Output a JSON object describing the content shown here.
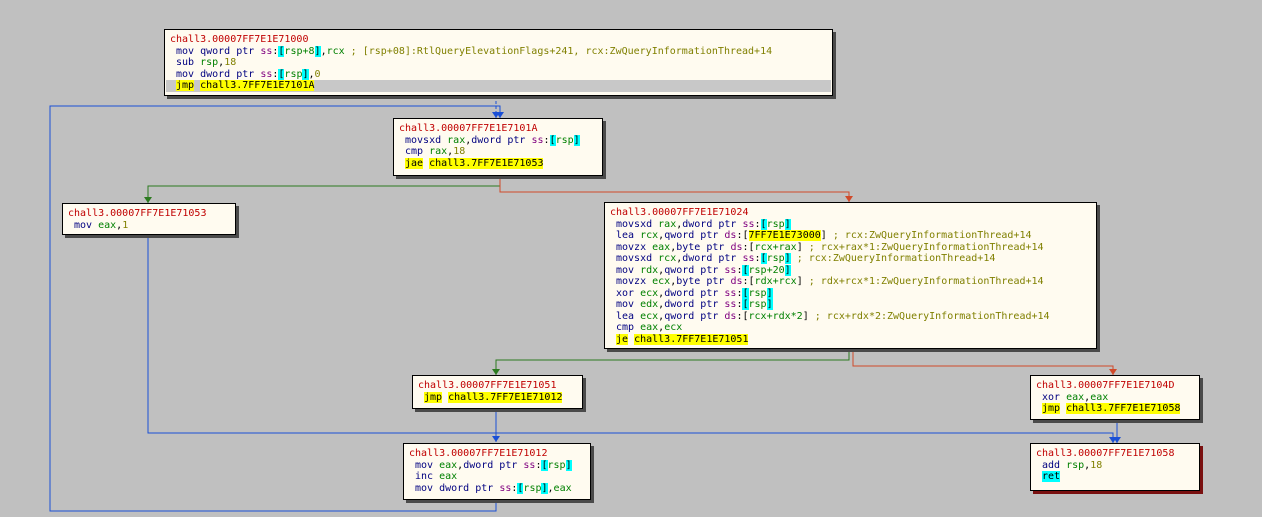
{
  "colors": {
    "background": "#c0c0c0",
    "edge_jump": "#1a4fd6",
    "edge_taken": "#2c7a1f",
    "edge_not_taken": "#d04a2a",
    "label": "#c00000"
  },
  "nodes": [
    {
      "id": "b1000",
      "label": "chall3.00007FF7E1E71000",
      "lines": [
        [
          {
            "t": "mov",
            "c": "m"
          },
          {
            "t": " "
          },
          {
            "t": "qword ptr",
            "c": "sz"
          },
          {
            "t": " "
          },
          {
            "t": "ss",
            "c": "seg"
          },
          {
            "t": ":",
            "c": "bk"
          },
          {
            "t": "[",
            "c": "hl"
          },
          {
            "t": "rsp+8",
            "c": "r"
          },
          {
            "t": "]",
            "c": "hl"
          },
          {
            "t": ",",
            "c": "bk"
          },
          {
            "t": "rcx",
            "c": "r"
          },
          {
            "t": " ; [rsp+08]:RtlQueryElevationFlags+241, rcx:ZwQueryInformationThread+14",
            "c": "cm"
          }
        ],
        [
          {
            "t": "sub",
            "c": "m"
          },
          {
            "t": " "
          },
          {
            "t": "rsp",
            "c": "r"
          },
          {
            "t": ",",
            "c": "bk"
          },
          {
            "t": "18",
            "c": "n"
          }
        ],
        [
          {
            "t": "mov",
            "c": "m"
          },
          {
            "t": " "
          },
          {
            "t": "dword ptr",
            "c": "sz"
          },
          {
            "t": " "
          },
          {
            "t": "ss",
            "c": "seg"
          },
          {
            "t": ":",
            "c": "bk"
          },
          {
            "t": "[",
            "c": "hl"
          },
          {
            "t": "rsp",
            "c": "r"
          },
          {
            "t": "]",
            "c": "hl"
          },
          {
            "t": ",",
            "c": "bk"
          },
          {
            "t": "0",
            "c": "n"
          }
        ],
        [
          {
            "t": "jmp",
            "c": "mj"
          },
          {
            "t": " "
          },
          {
            "t": "chall3.7FF7E1E7101A",
            "c": "tg"
          }
        ]
      ]
    },
    {
      "id": "b101A",
      "label": "chall3.00007FF7E1E7101A",
      "lines": [
        [
          {
            "t": "movsxd",
            "c": "m"
          },
          {
            "t": " "
          },
          {
            "t": "rax",
            "c": "r"
          },
          {
            "t": ",",
            "c": "bk"
          },
          {
            "t": "dword ptr",
            "c": "sz"
          },
          {
            "t": " "
          },
          {
            "t": "ss",
            "c": "seg"
          },
          {
            "t": ":",
            "c": "bk"
          },
          {
            "t": "[",
            "c": "hl"
          },
          {
            "t": "rsp",
            "c": "r"
          },
          {
            "t": "]",
            "c": "hl"
          }
        ],
        [
          {
            "t": "cmp",
            "c": "m"
          },
          {
            "t": " "
          },
          {
            "t": "rax",
            "c": "r"
          },
          {
            "t": ",",
            "c": "bk"
          },
          {
            "t": "18",
            "c": "n"
          }
        ],
        [
          {
            "t": "jae",
            "c": "mj"
          },
          {
            "t": " "
          },
          {
            "t": "chall3.7FF7E1E71053",
            "c": "tg"
          }
        ]
      ]
    },
    {
      "id": "b1053",
      "label": "chall3.00007FF7E1E71053",
      "lines": [
        [
          {
            "t": "mov",
            "c": "m"
          },
          {
            "t": " "
          },
          {
            "t": "eax",
            "c": "r"
          },
          {
            "t": ",",
            "c": "bk"
          },
          {
            "t": "1",
            "c": "n"
          }
        ]
      ]
    },
    {
      "id": "b1024",
      "label": "chall3.00007FF7E1E71024",
      "lines": [
        [
          {
            "t": "movsxd",
            "c": "m"
          },
          {
            "t": " "
          },
          {
            "t": "rax",
            "c": "r"
          },
          {
            "t": ",",
            "c": "bk"
          },
          {
            "t": "dword ptr",
            "c": "sz"
          },
          {
            "t": " "
          },
          {
            "t": "ss",
            "c": "seg"
          },
          {
            "t": ":",
            "c": "bk"
          },
          {
            "t": "[",
            "c": "hl"
          },
          {
            "t": "rsp",
            "c": "r"
          },
          {
            "t": "]",
            "c": "hl"
          }
        ],
        [
          {
            "t": "lea",
            "c": "m"
          },
          {
            "t": " "
          },
          {
            "t": "rcx",
            "c": "r"
          },
          {
            "t": ",",
            "c": "bk"
          },
          {
            "t": "qword ptr",
            "c": "sz"
          },
          {
            "t": " "
          },
          {
            "t": "ds",
            "c": "seg"
          },
          {
            "t": ":",
            "c": "bk"
          },
          {
            "t": "[",
            "c": "bk"
          },
          {
            "t": "7FF7E1E73000",
            "c": "tg"
          },
          {
            "t": "]",
            "c": "bk"
          },
          {
            "t": " ; rcx:ZwQueryInformationThread+14",
            "c": "cm"
          }
        ],
        [
          {
            "t": "movzx",
            "c": "m"
          },
          {
            "t": " "
          },
          {
            "t": "eax",
            "c": "r"
          },
          {
            "t": ",",
            "c": "bk"
          },
          {
            "t": "byte ptr",
            "c": "sz"
          },
          {
            "t": " "
          },
          {
            "t": "ds",
            "c": "seg"
          },
          {
            "t": ":",
            "c": "bk"
          },
          {
            "t": "[",
            "c": "bk"
          },
          {
            "t": "rcx+rax",
            "c": "r"
          },
          {
            "t": "]",
            "c": "bk"
          },
          {
            "t": " ; rcx+rax*1:ZwQueryInformationThread+14",
            "c": "cm"
          }
        ],
        [
          {
            "t": "movsxd",
            "c": "m"
          },
          {
            "t": " "
          },
          {
            "t": "rcx",
            "c": "r"
          },
          {
            "t": ",",
            "c": "bk"
          },
          {
            "t": "dword ptr",
            "c": "sz"
          },
          {
            "t": " "
          },
          {
            "t": "ss",
            "c": "seg"
          },
          {
            "t": ":",
            "c": "bk"
          },
          {
            "t": "[",
            "c": "hl"
          },
          {
            "t": "rsp",
            "c": "r"
          },
          {
            "t": "]",
            "c": "hl"
          },
          {
            "t": " ; rcx:ZwQueryInformationThread+14",
            "c": "cm"
          }
        ],
        [
          {
            "t": "mov",
            "c": "m"
          },
          {
            "t": " "
          },
          {
            "t": "rdx",
            "c": "r"
          },
          {
            "t": ",",
            "c": "bk"
          },
          {
            "t": "qword ptr",
            "c": "sz"
          },
          {
            "t": " "
          },
          {
            "t": "ss",
            "c": "seg"
          },
          {
            "t": ":",
            "c": "bk"
          },
          {
            "t": "[",
            "c": "hl"
          },
          {
            "t": "rsp+20",
            "c": "r"
          },
          {
            "t": "]",
            "c": "hl"
          }
        ],
        [
          {
            "t": "movzx",
            "c": "m"
          },
          {
            "t": " "
          },
          {
            "t": "ecx",
            "c": "r"
          },
          {
            "t": ",",
            "c": "bk"
          },
          {
            "t": "byte ptr",
            "c": "sz"
          },
          {
            "t": " "
          },
          {
            "t": "ds",
            "c": "seg"
          },
          {
            "t": ":",
            "c": "bk"
          },
          {
            "t": "[",
            "c": "bk"
          },
          {
            "t": "rdx+rcx",
            "c": "r"
          },
          {
            "t": "]",
            "c": "bk"
          },
          {
            "t": " ; rdx+rcx*1:ZwQueryInformationThread+14",
            "c": "cm"
          }
        ],
        [
          {
            "t": "xor",
            "c": "m"
          },
          {
            "t": " "
          },
          {
            "t": "ecx",
            "c": "r"
          },
          {
            "t": ",",
            "c": "bk"
          },
          {
            "t": "dword ptr",
            "c": "sz"
          },
          {
            "t": " "
          },
          {
            "t": "ss",
            "c": "seg"
          },
          {
            "t": ":",
            "c": "bk"
          },
          {
            "t": "[",
            "c": "hl"
          },
          {
            "t": "rsp",
            "c": "r"
          },
          {
            "t": "]",
            "c": "hl"
          }
        ],
        [
          {
            "t": "mov",
            "c": "m"
          },
          {
            "t": " "
          },
          {
            "t": "edx",
            "c": "r"
          },
          {
            "t": ",",
            "c": "bk"
          },
          {
            "t": "dword ptr",
            "c": "sz"
          },
          {
            "t": " "
          },
          {
            "t": "ss",
            "c": "seg"
          },
          {
            "t": ":",
            "c": "bk"
          },
          {
            "t": "[",
            "c": "hl"
          },
          {
            "t": "rsp",
            "c": "r"
          },
          {
            "t": "]",
            "c": "hl"
          }
        ],
        [
          {
            "t": "lea",
            "c": "m"
          },
          {
            "t": " "
          },
          {
            "t": "ecx",
            "c": "r"
          },
          {
            "t": ",",
            "c": "bk"
          },
          {
            "t": "qword ptr",
            "c": "sz"
          },
          {
            "t": " "
          },
          {
            "t": "ds",
            "c": "seg"
          },
          {
            "t": ":",
            "c": "bk"
          },
          {
            "t": "[",
            "c": "bk"
          },
          {
            "t": "rcx+rdx*2",
            "c": "r"
          },
          {
            "t": "]",
            "c": "bk"
          },
          {
            "t": " ; rcx+rdx*2:ZwQueryInformationThread+14",
            "c": "cm"
          }
        ],
        [
          {
            "t": "cmp",
            "c": "m"
          },
          {
            "t": " "
          },
          {
            "t": "eax",
            "c": "r"
          },
          {
            "t": ",",
            "c": "bk"
          },
          {
            "t": "ecx",
            "c": "r"
          }
        ],
        [
          {
            "t": "je",
            "c": "mj"
          },
          {
            "t": " "
          },
          {
            "t": "chall3.7FF7E1E71051",
            "c": "tg"
          }
        ]
      ]
    },
    {
      "id": "b1051",
      "label": "chall3.00007FF7E1E71051",
      "lines": [
        [
          {
            "t": "jmp",
            "c": "mj"
          },
          {
            "t": " "
          },
          {
            "t": "chall3.7FF7E1E71012",
            "c": "tg"
          }
        ]
      ]
    },
    {
      "id": "b104D",
      "label": "chall3.00007FF7E1E7104D",
      "lines": [
        [
          {
            "t": "xor",
            "c": "m"
          },
          {
            "t": " "
          },
          {
            "t": "eax",
            "c": "r"
          },
          {
            "t": ",",
            "c": "bk"
          },
          {
            "t": "eax",
            "c": "r"
          }
        ],
        [
          {
            "t": "jmp",
            "c": "mj"
          },
          {
            "t": " "
          },
          {
            "t": "chall3.7FF7E1E71058",
            "c": "tg"
          }
        ]
      ]
    },
    {
      "id": "b1012",
      "label": "chall3.00007FF7E1E71012",
      "lines": [
        [
          {
            "t": "mov",
            "c": "m"
          },
          {
            "t": " "
          },
          {
            "t": "eax",
            "c": "r"
          },
          {
            "t": ",",
            "c": "bk"
          },
          {
            "t": "dword ptr",
            "c": "sz"
          },
          {
            "t": " "
          },
          {
            "t": "ss",
            "c": "seg"
          },
          {
            "t": ":",
            "c": "bk"
          },
          {
            "t": "[",
            "c": "hl"
          },
          {
            "t": "rsp",
            "c": "r"
          },
          {
            "t": "]",
            "c": "hl"
          }
        ],
        [
          {
            "t": "inc",
            "c": "m"
          },
          {
            "t": " "
          },
          {
            "t": "eax",
            "c": "r"
          }
        ],
        [
          {
            "t": "mov",
            "c": "m"
          },
          {
            "t": " "
          },
          {
            "t": "dword ptr",
            "c": "sz"
          },
          {
            "t": " "
          },
          {
            "t": "ss",
            "c": "seg"
          },
          {
            "t": ":",
            "c": "bk"
          },
          {
            "t": "[",
            "c": "hl"
          },
          {
            "t": "rsp",
            "c": "r"
          },
          {
            "t": "]",
            "c": "hl"
          },
          {
            "t": ",",
            "c": "bk"
          },
          {
            "t": "eax",
            "c": "r"
          }
        ]
      ]
    },
    {
      "id": "b1058",
      "label": "chall3.00007FF7E1E71058",
      "lines": [
        [
          {
            "t": "add",
            "c": "m"
          },
          {
            "t": " "
          },
          {
            "t": "rsp",
            "c": "r"
          },
          {
            "t": ",",
            "c": "bk"
          },
          {
            "t": "18",
            "c": "n"
          }
        ],
        [
          {
            "t": "ret",
            "c": "hl"
          }
        ]
      ]
    }
  ],
  "edges": [
    {
      "from": "b1000",
      "to": "b101A",
      "kind": "jump"
    },
    {
      "from": "b101A",
      "to": "b1053",
      "kind": "taken"
    },
    {
      "from": "b101A",
      "to": "b1024",
      "kind": "not_taken"
    },
    {
      "from": "b1024",
      "to": "b1051",
      "kind": "taken"
    },
    {
      "from": "b1024",
      "to": "b104D",
      "kind": "not_taken"
    },
    {
      "from": "b1051",
      "to": "b1012",
      "kind": "jump"
    },
    {
      "from": "b1053",
      "to": "b1058",
      "kind": "jump"
    },
    {
      "from": "b104D",
      "to": "b1058",
      "kind": "jump"
    },
    {
      "from": "b1012",
      "to": "b101A",
      "kind": "jump"
    }
  ]
}
